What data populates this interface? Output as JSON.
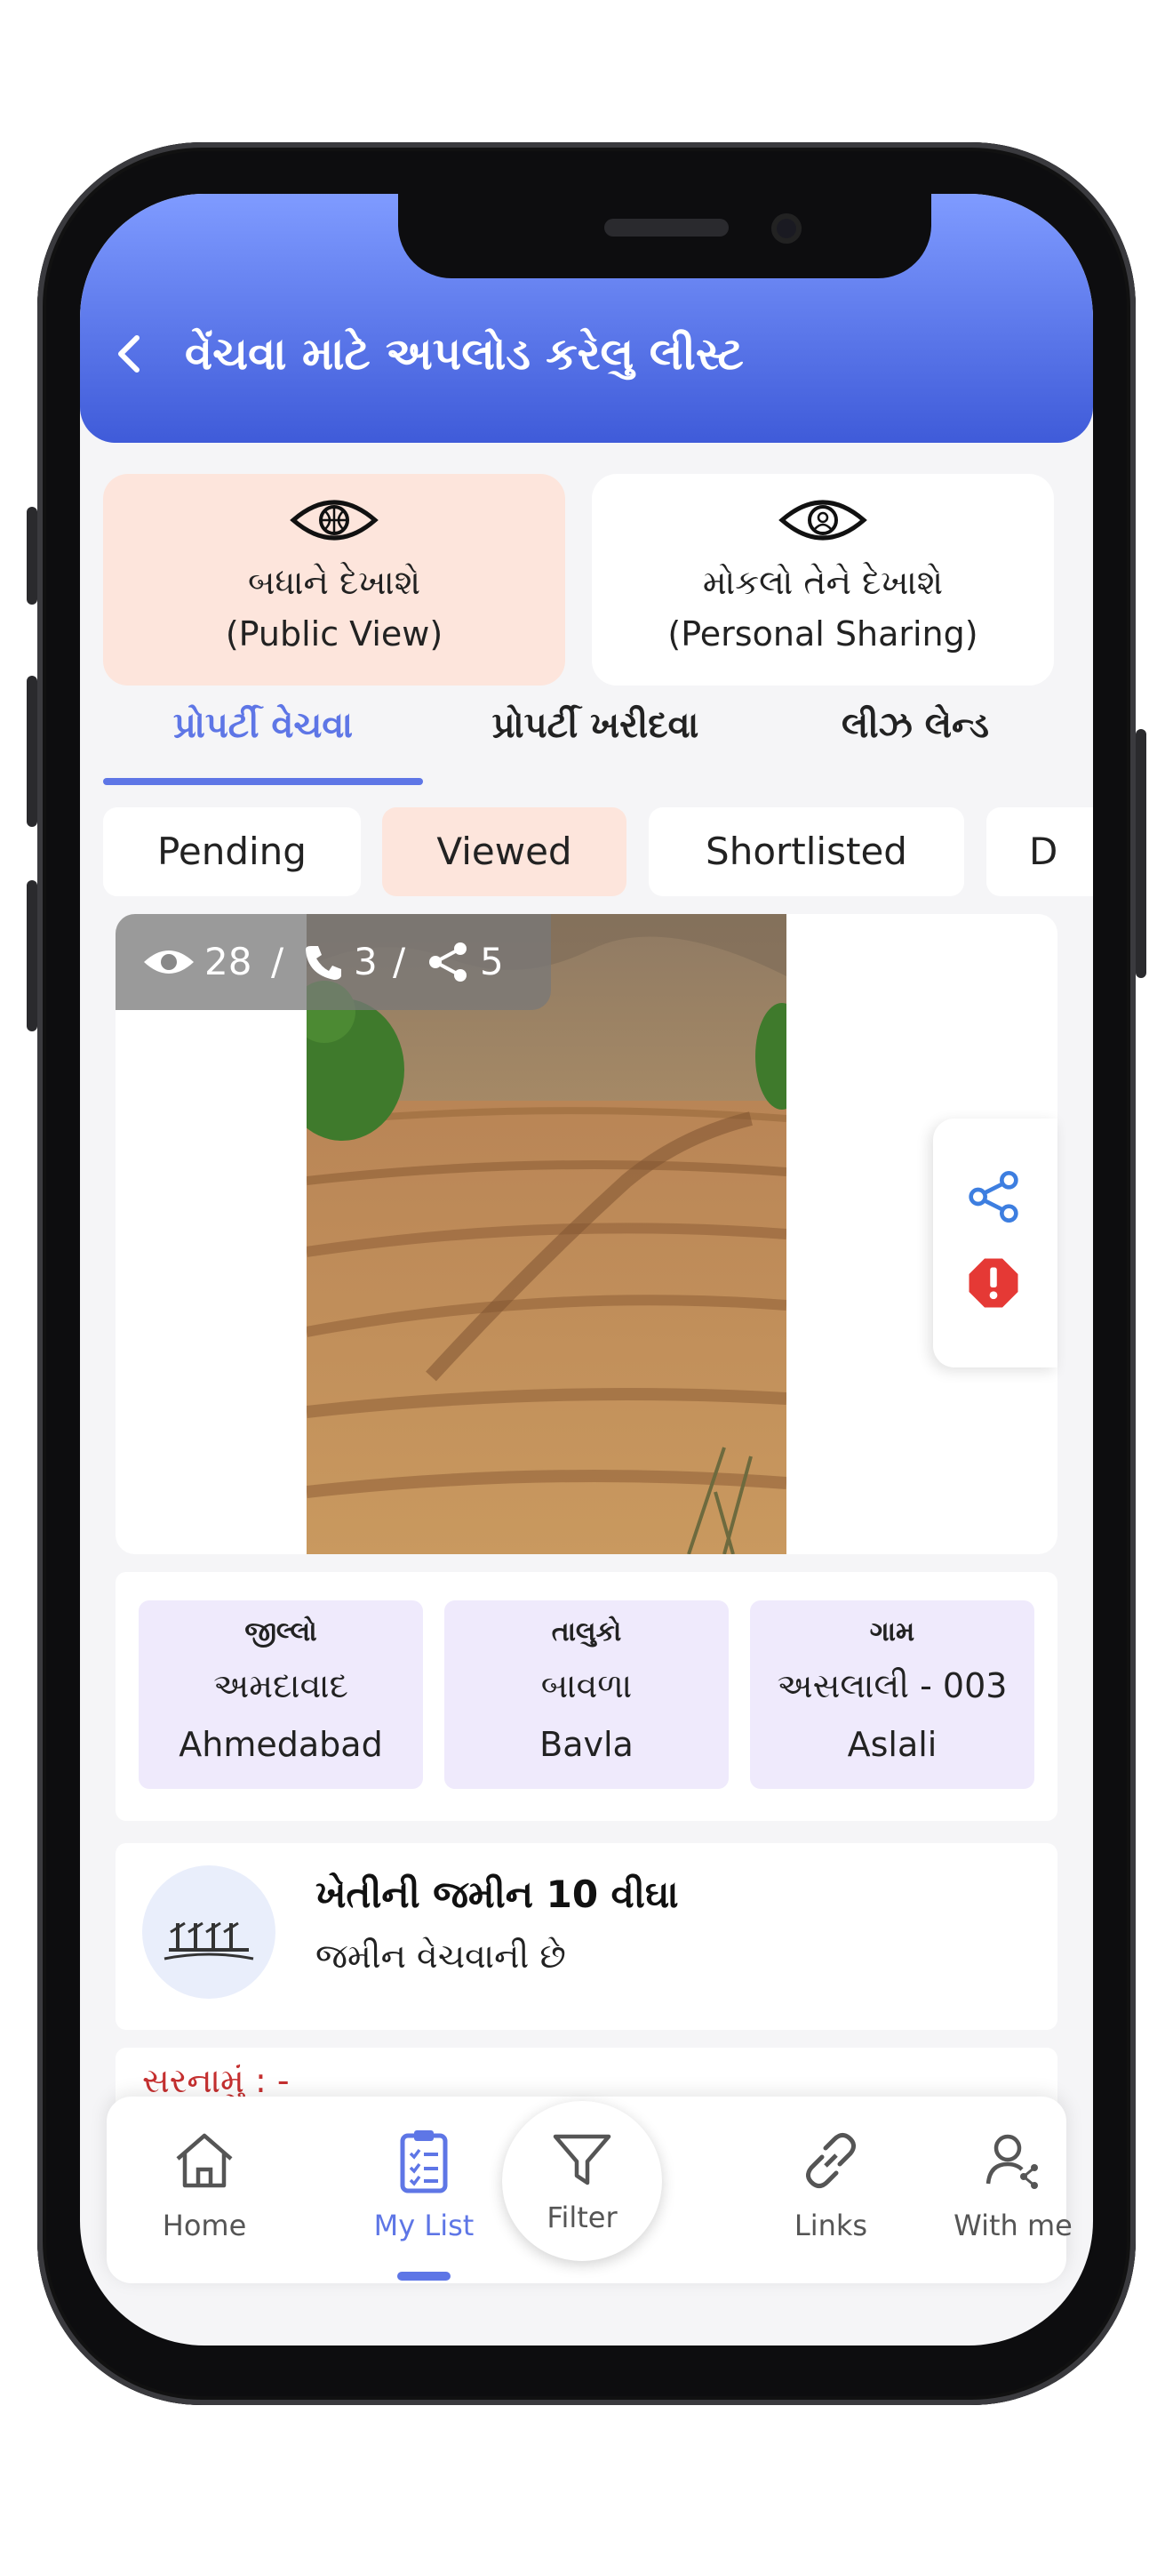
{
  "header": {
    "back_glyph": "<",
    "title": "વેંચવા માટે અપલોડ કરેલુ લીસ્ટ"
  },
  "view_modes": [
    {
      "line1": "બધાને દેખાશે",
      "line2": "(Public View)",
      "icon": "eye-globe-icon",
      "color": "#fde5dc"
    },
    {
      "line1": "મોકલો તેને દેખાશે",
      "line2": "(Personal Sharing)",
      "icon": "eye-person-icon",
      "color": "#ffffff"
    }
  ],
  "tabs": [
    {
      "label": "પ્રોપર્ટી વેચવા",
      "active": true
    },
    {
      "label": "પ્રોપર્ટી ખરીદવા",
      "active": false
    },
    {
      "label": "લીઝ લેન્ડ",
      "active": false
    }
  ],
  "filters": [
    {
      "label": "Pending",
      "active": false
    },
    {
      "label": "Viewed",
      "active": true
    },
    {
      "label": "Shortlisted",
      "active": false
    },
    {
      "label": "D",
      "active": false
    }
  ],
  "stats": {
    "views": "28",
    "calls": "3",
    "shares": "5",
    "separator": "/"
  },
  "location": [
    {
      "heading": "જીલ્લો",
      "gujarati": "અમદાવાદ",
      "english": "Ahmedabad"
    },
    {
      "heading": "તાલુકો",
      "gujarati": "બાવળા",
      "english": "Bavla"
    },
    {
      "heading": "ગામ",
      "gujarati": "અસલાલી - 003",
      "english": "Aslali"
    }
  ],
  "property": {
    "title": "ખેતીની જમીન 10 વીઘા",
    "subtitle": "જમીન વેચવાની છે"
  },
  "next_label": "સરનામું : -",
  "bottom_nav": [
    {
      "label": "Home",
      "icon": "home-icon",
      "active": false
    },
    {
      "label": "My List",
      "icon": "clipboard-list-icon",
      "active": true
    },
    {
      "label": "Filter",
      "icon": "filter-icon",
      "active": false
    },
    {
      "label": "Links",
      "icon": "link-icon",
      "active": false
    },
    {
      "label": "With me",
      "icon": "user-share-icon",
      "active": false
    }
  ],
  "colors": {
    "accent": "#5e76e6",
    "header_top": "#7f9bff",
    "header_bottom": "#3f5bd9",
    "active_chip": "#fde5dc",
    "info_box": "#efeafc",
    "alert": "#e53935"
  }
}
